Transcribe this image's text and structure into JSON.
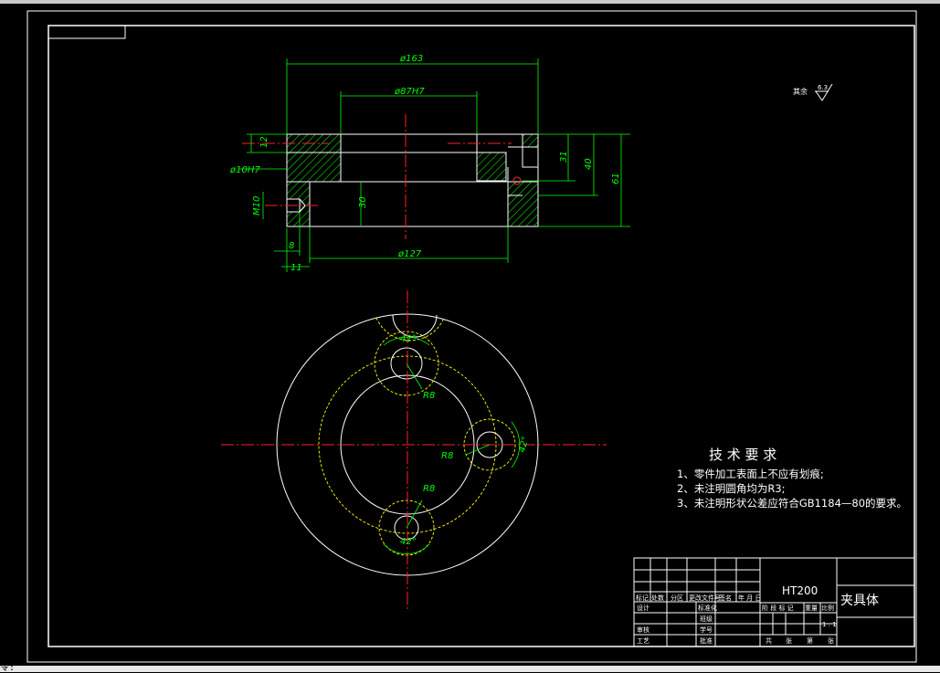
{
  "dimensions": {
    "d163": "ø163",
    "d87h7": "ø87H7",
    "d127": "ø127",
    "d10h7": "ø10H7",
    "m10": "M10",
    "v12": "12",
    "v30": "30",
    "v31": "31",
    "v40": "40",
    "v61": "61",
    "v8": "8",
    "v11": "11",
    "r8_top": "R8",
    "r8_mid": "R8",
    "r8_bot": "R8",
    "ang_top": "42°",
    "ang_right": "42°",
    "ang_bot": "42°"
  },
  "surface_finish": {
    "label": "其余",
    "value": "6.3"
  },
  "technical_requirements": {
    "title": "技 术 要 求",
    "items": [
      "1、零件加工表面上不应有划痕;",
      "2、未注明圆角均为R3;",
      "3、未注明形状公差应符合GB1184—80的要求。"
    ]
  },
  "title_block": {
    "material": "HT200",
    "part_name": "夹具体",
    "scale": "1 : 1",
    "header_cells": [
      "标记",
      "处数",
      "分区",
      "更改文件号",
      "签名",
      "年 月 日"
    ],
    "left_labels": [
      "设计",
      "审核",
      "工艺"
    ],
    "mid_labels": [
      "标准化",
      "班级",
      "学号",
      "批准"
    ],
    "stage_labels": [
      "阶 段 标 记",
      "重量",
      "比例"
    ],
    "sheet_labels": [
      "共",
      "张",
      "第",
      "张"
    ]
  },
  "status_bar": {
    "text": "令:"
  }
}
